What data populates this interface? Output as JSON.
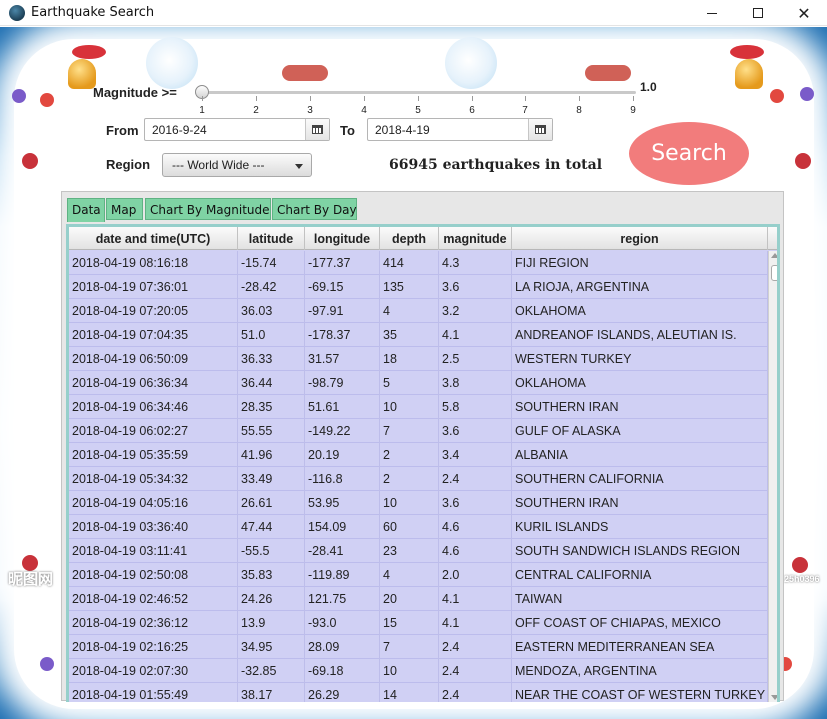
{
  "window": {
    "title": "Earthquake Search",
    "minimize_glyph": "",
    "maximize_glyph": "",
    "close_glyph": "✕"
  },
  "controls": {
    "magnitude_label": "Magnitude >=",
    "magnitude_value": "1.0",
    "magnitude_ticks": [
      "1",
      "2",
      "3",
      "4",
      "5",
      "6",
      "7",
      "8",
      "9"
    ],
    "from_label": "From",
    "from_value": "2016-9-24",
    "to_label": "To",
    "to_value": "2018-4-19",
    "region_label": "Region",
    "region_value": "--- World Wide ---",
    "total_text": "66945 earthquakes in total",
    "search_label": "Search"
  },
  "tabs": [
    {
      "label": "Data"
    },
    {
      "label": "Map"
    },
    {
      "label": "Chart By Magnitude"
    },
    {
      "label": "Chart By Day"
    }
  ],
  "table": {
    "columns": [
      "date and time(UTC)",
      "latitude",
      "longitude",
      "depth",
      "magnitude",
      "region"
    ],
    "rows": [
      [
        "2018-04-19 08:16:18",
        "-15.74",
        "-177.37",
        "414",
        "4.3",
        "FIJI REGION"
      ],
      [
        "2018-04-19 07:36:01",
        "-28.42",
        "-69.15",
        "135",
        "3.6",
        "LA RIOJA, ARGENTINA"
      ],
      [
        "2018-04-19 07:20:05",
        "36.03",
        "-97.91",
        "4",
        "3.2",
        "OKLAHOMA"
      ],
      [
        "2018-04-19 07:04:35",
        "51.0",
        "-178.37",
        "35",
        "4.1",
        "ANDREANOF ISLANDS, ALEUTIAN IS."
      ],
      [
        "2018-04-19 06:50:09",
        "36.33",
        "31.57",
        "18",
        "2.5",
        "WESTERN TURKEY"
      ],
      [
        "2018-04-19 06:36:34",
        "36.44",
        "-98.79",
        "5",
        "3.8",
        "OKLAHOMA"
      ],
      [
        "2018-04-19 06:34:46",
        "28.35",
        "51.61",
        "10",
        "5.8",
        "SOUTHERN IRAN"
      ],
      [
        "2018-04-19 06:02:27",
        "55.55",
        "-149.22",
        "7",
        "3.6",
        "GULF OF ALASKA"
      ],
      [
        "2018-04-19 05:35:59",
        "41.96",
        "20.19",
        "2",
        "3.4",
        "ALBANIA"
      ],
      [
        "2018-04-19 05:34:32",
        "33.49",
        "-116.8",
        "2",
        "2.4",
        "SOUTHERN CALIFORNIA"
      ],
      [
        "2018-04-19 04:05:16",
        "26.61",
        "53.95",
        "10",
        "3.6",
        "SOUTHERN IRAN"
      ],
      [
        "2018-04-19 03:36:40",
        "47.44",
        "154.09",
        "60",
        "4.6",
        "KURIL ISLANDS"
      ],
      [
        "2018-04-19 03:11:41",
        "-55.5",
        "-28.41",
        "23",
        "4.6",
        "SOUTH SANDWICH ISLANDS REGION"
      ],
      [
        "2018-04-19 02:50:08",
        "35.83",
        "-119.89",
        "4",
        "2.0",
        "CENTRAL CALIFORNIA"
      ],
      [
        "2018-04-19 02:46:52",
        "24.26",
        "121.75",
        "20",
        "4.1",
        "TAIWAN"
      ],
      [
        "2018-04-19 02:36:12",
        "13.9",
        "-93.0",
        "15",
        "4.1",
        "OFF COAST OF CHIAPAS, MEXICO"
      ],
      [
        "2018-04-19 02:16:25",
        "34.95",
        "28.09",
        "7",
        "2.4",
        "EASTERN MEDITERRANEAN SEA"
      ],
      [
        "2018-04-19 02:07:30",
        "-32.85",
        "-69.18",
        "10",
        "2.4",
        "MENDOZA, ARGENTINA"
      ],
      [
        "2018-04-19 01:55:49",
        "38.17",
        "26.29",
        "14",
        "2.4",
        "NEAR THE COAST OF WESTERN TURKEY"
      ]
    ]
  },
  "background": {
    "watermark_left": "昵图网",
    "watermark_right": "25h0396"
  },
  "colors": {
    "tab_bg": "#7fd3a4",
    "table_row_bg": "#d0d0f4",
    "search_button": "#f27c7c",
    "table_frame": "#96cfcb"
  }
}
